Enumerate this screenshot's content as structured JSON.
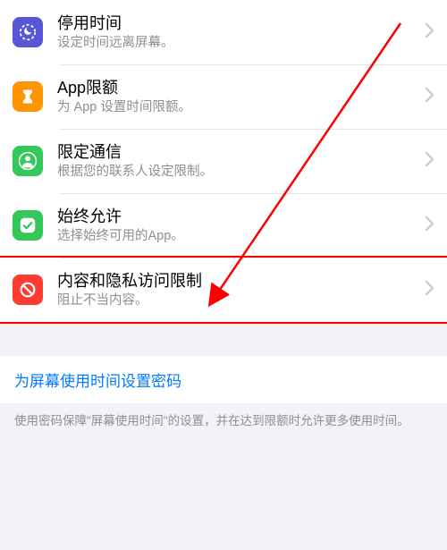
{
  "items": [
    {
      "id": "downtime",
      "title": "停用时间",
      "sub": "设定时间远离屏幕。",
      "icon": "clock-moon-icon",
      "iconClass": "ic-downtime"
    },
    {
      "id": "app-limits",
      "title": "App限额",
      "sub": "为 App 设置时间限额。",
      "icon": "hourglass-icon",
      "iconClass": "ic-limits"
    },
    {
      "id": "communication-limits",
      "title": "限定通信",
      "sub": "根据您的联系人设定限制。",
      "icon": "person-icon",
      "iconClass": "ic-comm"
    },
    {
      "id": "always-allowed",
      "title": "始终允许",
      "sub": "选择始终可用的App。",
      "icon": "checkmark-icon",
      "iconClass": "ic-always"
    },
    {
      "id": "content-privacy",
      "title": "内容和隐私访问限制",
      "sub": "阻止不当内容。",
      "icon": "no-symbol-icon",
      "iconClass": "ic-content",
      "highlighted": true
    }
  ],
  "passcode_link": "为屏幕使用时间设置密码",
  "footer_text": "使用密码保障\"屏幕使用时间\"的设置，并在达到限额时允许更多使用时间。",
  "colors": {
    "accent_blue": "#007aff",
    "annotation_red": "#ff0000"
  }
}
